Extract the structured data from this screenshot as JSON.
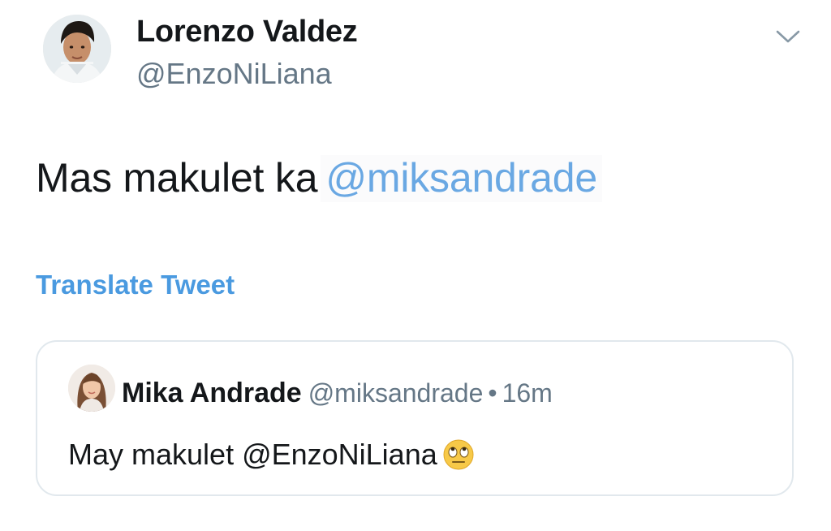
{
  "author": {
    "display_name": "Lorenzo Valdez",
    "handle": "@EnzoNiLiana"
  },
  "tweet": {
    "text": "Mas makulet ka",
    "mention": "@miksandrade",
    "translate_label": "Translate Tweet"
  },
  "quoted_tweet": {
    "display_name": "Mika Andrade",
    "handle": "@miksandrade",
    "separator": "•",
    "time": "16m",
    "text": "May makulet @EnzoNiLiana",
    "emoji": "face-with-rolling-eyes"
  },
  "icons": {
    "caret": "chevron-down-icon"
  },
  "colors": {
    "link": "#4a9ae0",
    "secondary_text": "#657786",
    "border": "#e1e8ed"
  }
}
